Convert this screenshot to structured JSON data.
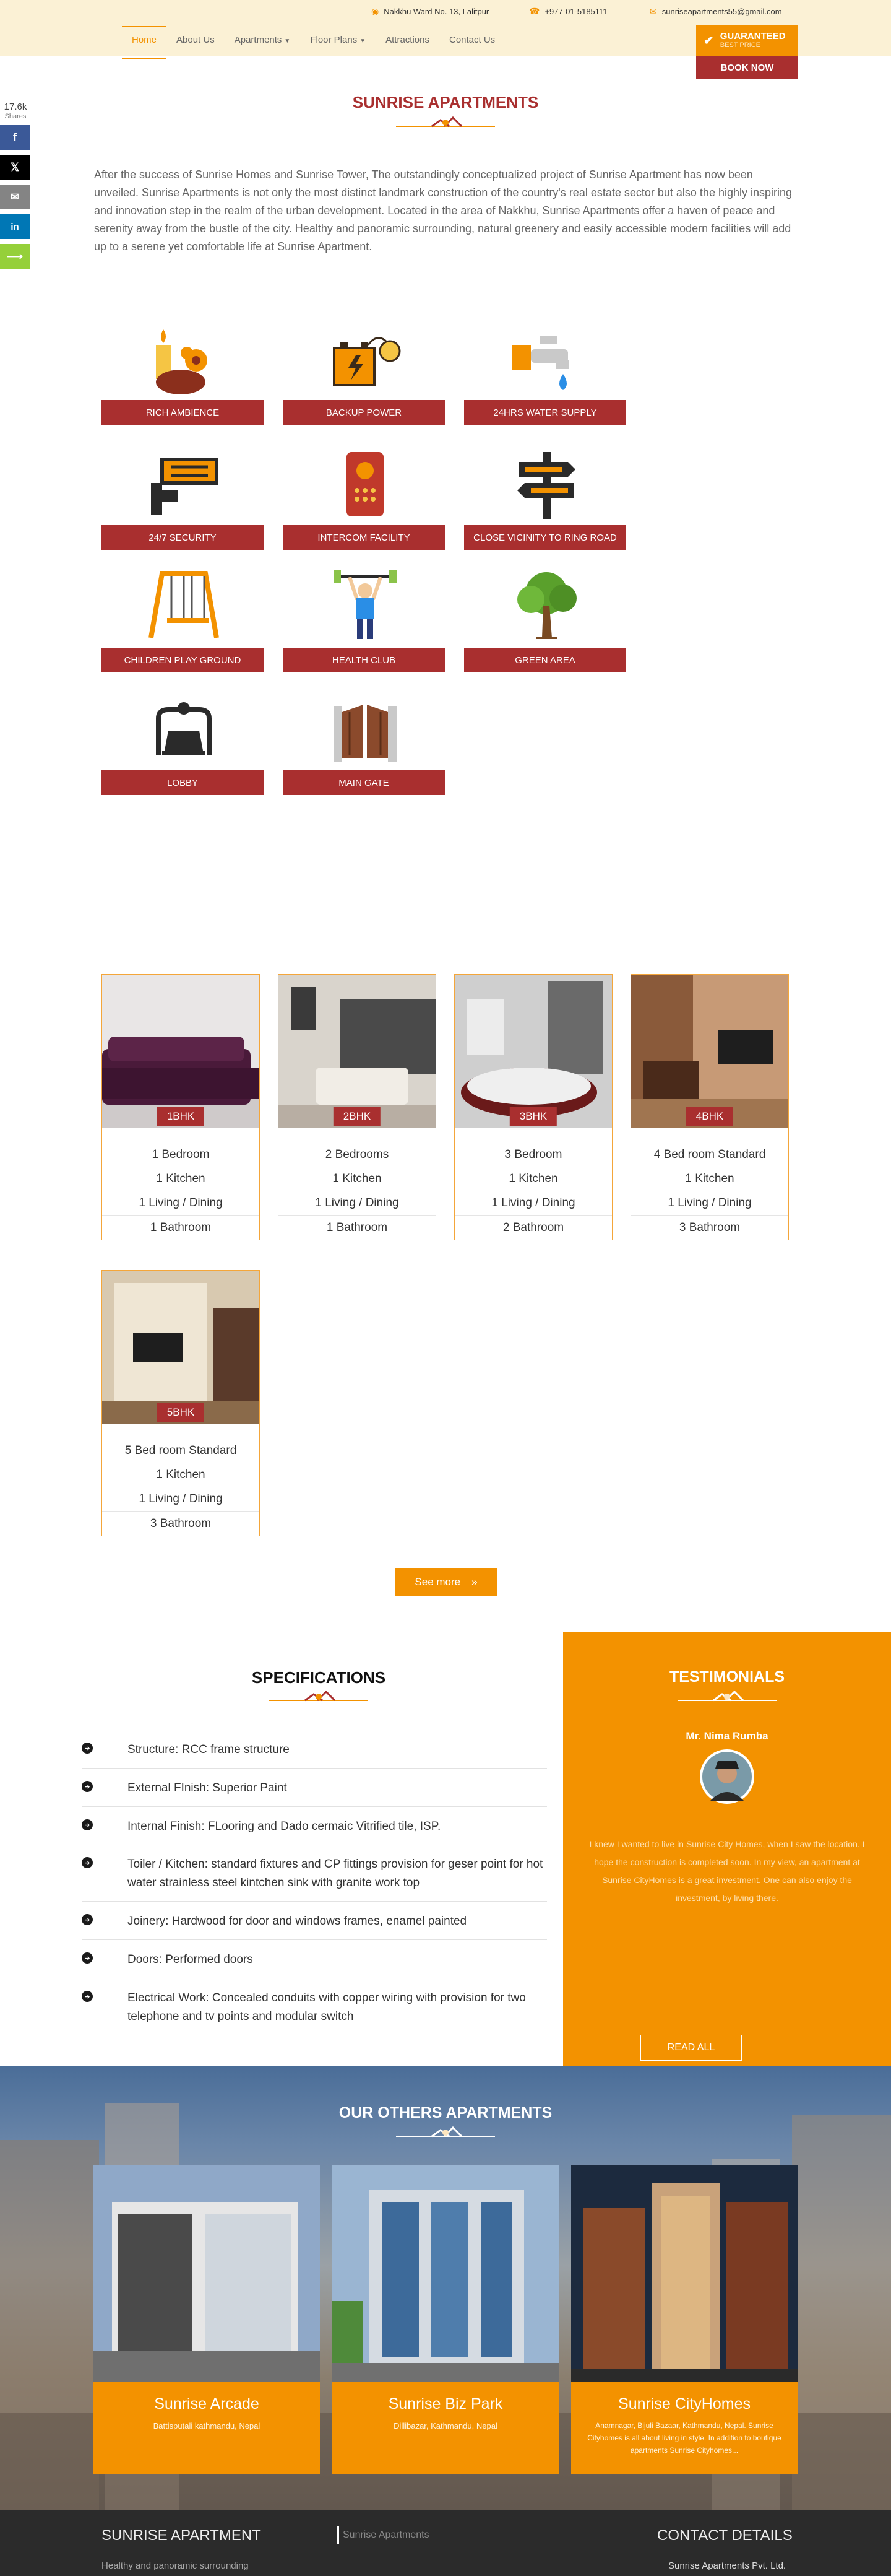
{
  "topbar": {
    "address": "Nakkhu Ward No. 13, Lalitpur",
    "phone": "+977-01-5185111",
    "email": "sunriseapartments55@gmail.com"
  },
  "nav": {
    "items": [
      {
        "label": "Home",
        "active": true
      },
      {
        "label": "About Us"
      },
      {
        "label": "Apartments",
        "dropdown": true
      },
      {
        "label": "Floor Plans",
        "dropdown": true
      },
      {
        "label": "Attractions"
      },
      {
        "label": "Contact Us"
      }
    ]
  },
  "guarantee": {
    "title": "GUARANTEED",
    "subtitle": "BEST PRICE",
    "book_label": "BOOK NOW"
  },
  "social": {
    "count": "17.6k",
    "label": "Shares",
    "colors": {
      "facebook": "#3b5998",
      "twitter": "#000000",
      "email": "#848484",
      "linkedin": "#0077b5",
      "share": "#95d03a"
    }
  },
  "about": {
    "title": "SUNRISE APARTMENTS",
    "text": "After the success of Sunrise Homes and Sunrise Tower, The outstandingly conceptualized project of Sunrise Apartment has now been unveiled. Sunrise Apartments is not only the most distinct landmark construction of the country's real estate sector but also the highly inspiring and innovation step in the realm of the urban development. Located in the area of Nakkhu, Sunrise Apartments offer a haven of peace and serenity away from the bustle of the city. Healthy and panoramic surrounding, natural greenery and easily accessible modern facilities will add up to a serene yet comfortable life at Sunrise Apartment."
  },
  "amenities": [
    {
      "label": "RICH AMBIENCE",
      "icon": "candle-flower-icon"
    },
    {
      "label": "BACKUP POWER",
      "icon": "battery-bulb-icon"
    },
    {
      "label": "24HRS WATER SUPPLY",
      "icon": "water-tap-icon"
    },
    {
      "label": "24/7 SECURITY",
      "icon": "cctv-camera-icon"
    },
    {
      "label": "INTERCOM FACILITY",
      "icon": "intercom-icon"
    },
    {
      "label": "CLOSE VICINITY TO RING ROAD",
      "icon": "signpost-icon"
    },
    {
      "label": "CHILDREN PLAY GROUND",
      "icon": "swing-icon"
    },
    {
      "label": "HEALTH CLUB",
      "icon": "weightlifter-icon"
    },
    {
      "label": "GREEN AREA",
      "icon": "tree-icon"
    },
    {
      "label": "LOBBY",
      "icon": "lobby-icon"
    },
    {
      "label": "MAIN GATE",
      "icon": "gate-icon"
    }
  ],
  "apartments": [
    {
      "badge": "1BHK",
      "rows": [
        "1 Bedroom",
        "1 Kitchen",
        "1 Living / Dining",
        "1 Bathroom"
      ]
    },
    {
      "badge": "2BHK",
      "rows": [
        "2 Bedrooms",
        "1 Kitchen",
        "1 Living / Dining",
        "1 Bathroom"
      ]
    },
    {
      "badge": "3BHK",
      "rows": [
        "3 Bedroom",
        "1 Kitchen",
        "1 Living / Dining",
        "2 Bathroom"
      ]
    },
    {
      "badge": "4BHK",
      "rows": [
        "4 Bed room Standard",
        "1 Kitchen",
        "1 Living / Dining",
        "3 Bathroom"
      ]
    },
    {
      "badge": "5BHK",
      "rows": [
        "5 Bed room Standard",
        "1 Kitchen",
        "1 Living / Dining",
        "3 Bathroom"
      ]
    }
  ],
  "see_more": "See more",
  "specifications": {
    "title": "SPECIFICATIONS",
    "items": [
      "Structure: RCC frame structure",
      "External FInish: Superior Paint",
      "Internal Finish: FLooring and Dado cermaic Vitrified tile, ISP.",
      "Toiler / Kitchen: standard fixtures and CP fittings provision for geser point for hot water strainless steel kintchen sink with granite work top",
      "Joinery: Hardwood for door and windows frames, enamel painted",
      "Doors: Performed doors",
      "Electrical Work: Concealed conduits with copper wiring with provision for two telephone and tv points and modular switch"
    ]
  },
  "testimonials": {
    "title": "TESTIMONIALS",
    "name": "Mr. Nima Rumba",
    "quote": "I knew I wanted to live in Sunrise City Homes, when I saw the location. I hope the construction is completed soon. In my view, an apartment at Sunrise CityHomes is a great investment. One can also enjoy the investment, by living there.",
    "read_all": "READ ALL"
  },
  "others": {
    "title": "OUR OTHERS APARTMENTS",
    "items": [
      {
        "name": "Sunrise Arcade",
        "desc": "Battisputali kathmandu, Nepal"
      },
      {
        "name": "Sunrise Biz Park",
        "desc": "Dillibazar, Kathmandu, Nepal"
      },
      {
        "name": "Sunrise CityHomes",
        "desc": "Anamnagar, Bijuli Bazaar, Kathmandu, Nepal. Sunrise Cityhomes is all about living in style. In addition to boutique apartments Sunrise Cityhomes..."
      }
    ]
  },
  "footer": {
    "col1_title": "SUNRISE APARTMENT",
    "col1_text": "Healthy and panoramic surrounding",
    "search_placeholder": "Sunrise Apartments",
    "col3_title": "CONTACT DETAILS",
    "col3_text": "Sunrise Apartments Pvt. Ltd."
  },
  "colors": {
    "accent": "#f39200",
    "brand_red": "#a92f2f",
    "header_bg": "#fbf1d5",
    "footer_bg": "#2b2b2b"
  }
}
